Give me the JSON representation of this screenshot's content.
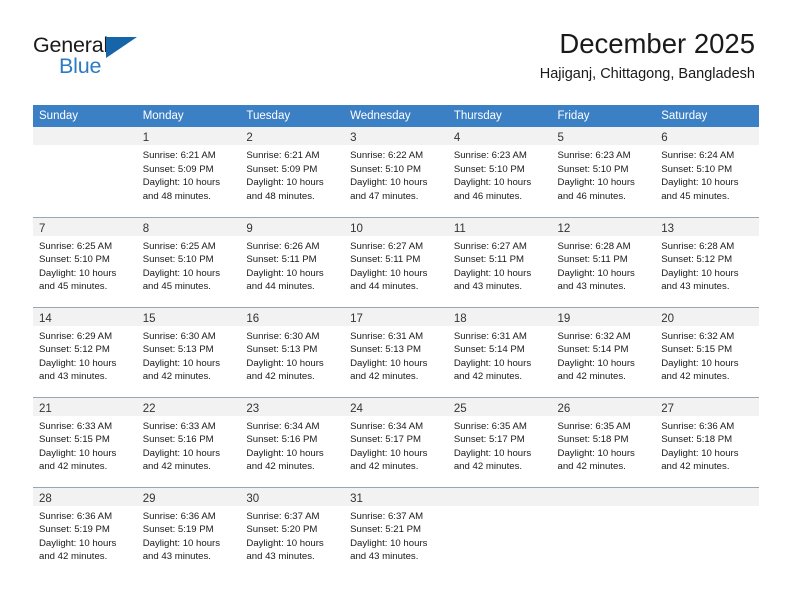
{
  "brand": {
    "name_part1": "General",
    "name_part2": "Blue",
    "flag_icon": "triangle-flag-icon",
    "accent_color": "#1565a8",
    "blue_text_color": "#2b7cc4"
  },
  "header": {
    "title": "December 2025",
    "subtitle": "Hajiganj, Chittagong, Bangladesh"
  },
  "calendar": {
    "header_bg": "#3b7fc4",
    "daynum_bg": "#f2f2f2",
    "weekdays": [
      "Sunday",
      "Monday",
      "Tuesday",
      "Wednesday",
      "Thursday",
      "Friday",
      "Saturday"
    ],
    "weeks": [
      [
        {
          "day": "",
          "lines": []
        },
        {
          "day": "1",
          "lines": [
            "Sunrise: 6:21 AM",
            "Sunset: 5:09 PM",
            "Daylight: 10 hours",
            "and 48 minutes."
          ]
        },
        {
          "day": "2",
          "lines": [
            "Sunrise: 6:21 AM",
            "Sunset: 5:09 PM",
            "Daylight: 10 hours",
            "and 48 minutes."
          ]
        },
        {
          "day": "3",
          "lines": [
            "Sunrise: 6:22 AM",
            "Sunset: 5:10 PM",
            "Daylight: 10 hours",
            "and 47 minutes."
          ]
        },
        {
          "day": "4",
          "lines": [
            "Sunrise: 6:23 AM",
            "Sunset: 5:10 PM",
            "Daylight: 10 hours",
            "and 46 minutes."
          ]
        },
        {
          "day": "5",
          "lines": [
            "Sunrise: 6:23 AM",
            "Sunset: 5:10 PM",
            "Daylight: 10 hours",
            "and 46 minutes."
          ]
        },
        {
          "day": "6",
          "lines": [
            "Sunrise: 6:24 AM",
            "Sunset: 5:10 PM",
            "Daylight: 10 hours",
            "and 45 minutes."
          ]
        }
      ],
      [
        {
          "day": "7",
          "lines": [
            "Sunrise: 6:25 AM",
            "Sunset: 5:10 PM",
            "Daylight: 10 hours",
            "and 45 minutes."
          ]
        },
        {
          "day": "8",
          "lines": [
            "Sunrise: 6:25 AM",
            "Sunset: 5:10 PM",
            "Daylight: 10 hours",
            "and 45 minutes."
          ]
        },
        {
          "day": "9",
          "lines": [
            "Sunrise: 6:26 AM",
            "Sunset: 5:11 PM",
            "Daylight: 10 hours",
            "and 44 minutes."
          ]
        },
        {
          "day": "10",
          "lines": [
            "Sunrise: 6:27 AM",
            "Sunset: 5:11 PM",
            "Daylight: 10 hours",
            "and 44 minutes."
          ]
        },
        {
          "day": "11",
          "lines": [
            "Sunrise: 6:27 AM",
            "Sunset: 5:11 PM",
            "Daylight: 10 hours",
            "and 43 minutes."
          ]
        },
        {
          "day": "12",
          "lines": [
            "Sunrise: 6:28 AM",
            "Sunset: 5:11 PM",
            "Daylight: 10 hours",
            "and 43 minutes."
          ]
        },
        {
          "day": "13",
          "lines": [
            "Sunrise: 6:28 AM",
            "Sunset: 5:12 PM",
            "Daylight: 10 hours",
            "and 43 minutes."
          ]
        }
      ],
      [
        {
          "day": "14",
          "lines": [
            "Sunrise: 6:29 AM",
            "Sunset: 5:12 PM",
            "Daylight: 10 hours",
            "and 43 minutes."
          ]
        },
        {
          "day": "15",
          "lines": [
            "Sunrise: 6:30 AM",
            "Sunset: 5:13 PM",
            "Daylight: 10 hours",
            "and 42 minutes."
          ]
        },
        {
          "day": "16",
          "lines": [
            "Sunrise: 6:30 AM",
            "Sunset: 5:13 PM",
            "Daylight: 10 hours",
            "and 42 minutes."
          ]
        },
        {
          "day": "17",
          "lines": [
            "Sunrise: 6:31 AM",
            "Sunset: 5:13 PM",
            "Daylight: 10 hours",
            "and 42 minutes."
          ]
        },
        {
          "day": "18",
          "lines": [
            "Sunrise: 6:31 AM",
            "Sunset: 5:14 PM",
            "Daylight: 10 hours",
            "and 42 minutes."
          ]
        },
        {
          "day": "19",
          "lines": [
            "Sunrise: 6:32 AM",
            "Sunset: 5:14 PM",
            "Daylight: 10 hours",
            "and 42 minutes."
          ]
        },
        {
          "day": "20",
          "lines": [
            "Sunrise: 6:32 AM",
            "Sunset: 5:15 PM",
            "Daylight: 10 hours",
            "and 42 minutes."
          ]
        }
      ],
      [
        {
          "day": "21",
          "lines": [
            "Sunrise: 6:33 AM",
            "Sunset: 5:15 PM",
            "Daylight: 10 hours",
            "and 42 minutes."
          ]
        },
        {
          "day": "22",
          "lines": [
            "Sunrise: 6:33 AM",
            "Sunset: 5:16 PM",
            "Daylight: 10 hours",
            "and 42 minutes."
          ]
        },
        {
          "day": "23",
          "lines": [
            "Sunrise: 6:34 AM",
            "Sunset: 5:16 PM",
            "Daylight: 10 hours",
            "and 42 minutes."
          ]
        },
        {
          "day": "24",
          "lines": [
            "Sunrise: 6:34 AM",
            "Sunset: 5:17 PM",
            "Daylight: 10 hours",
            "and 42 minutes."
          ]
        },
        {
          "day": "25",
          "lines": [
            "Sunrise: 6:35 AM",
            "Sunset: 5:17 PM",
            "Daylight: 10 hours",
            "and 42 minutes."
          ]
        },
        {
          "day": "26",
          "lines": [
            "Sunrise: 6:35 AM",
            "Sunset: 5:18 PM",
            "Daylight: 10 hours",
            "and 42 minutes."
          ]
        },
        {
          "day": "27",
          "lines": [
            "Sunrise: 6:36 AM",
            "Sunset: 5:18 PM",
            "Daylight: 10 hours",
            "and 42 minutes."
          ]
        }
      ],
      [
        {
          "day": "28",
          "lines": [
            "Sunrise: 6:36 AM",
            "Sunset: 5:19 PM",
            "Daylight: 10 hours",
            "and 42 minutes."
          ]
        },
        {
          "day": "29",
          "lines": [
            "Sunrise: 6:36 AM",
            "Sunset: 5:19 PM",
            "Daylight: 10 hours",
            "and 43 minutes."
          ]
        },
        {
          "day": "30",
          "lines": [
            "Sunrise: 6:37 AM",
            "Sunset: 5:20 PM",
            "Daylight: 10 hours",
            "and 43 minutes."
          ]
        },
        {
          "day": "31",
          "lines": [
            "Sunrise: 6:37 AM",
            "Sunset: 5:21 PM",
            "Daylight: 10 hours",
            "and 43 minutes."
          ]
        },
        {
          "day": "",
          "lines": []
        },
        {
          "day": "",
          "lines": []
        },
        {
          "day": "",
          "lines": []
        }
      ]
    ]
  }
}
